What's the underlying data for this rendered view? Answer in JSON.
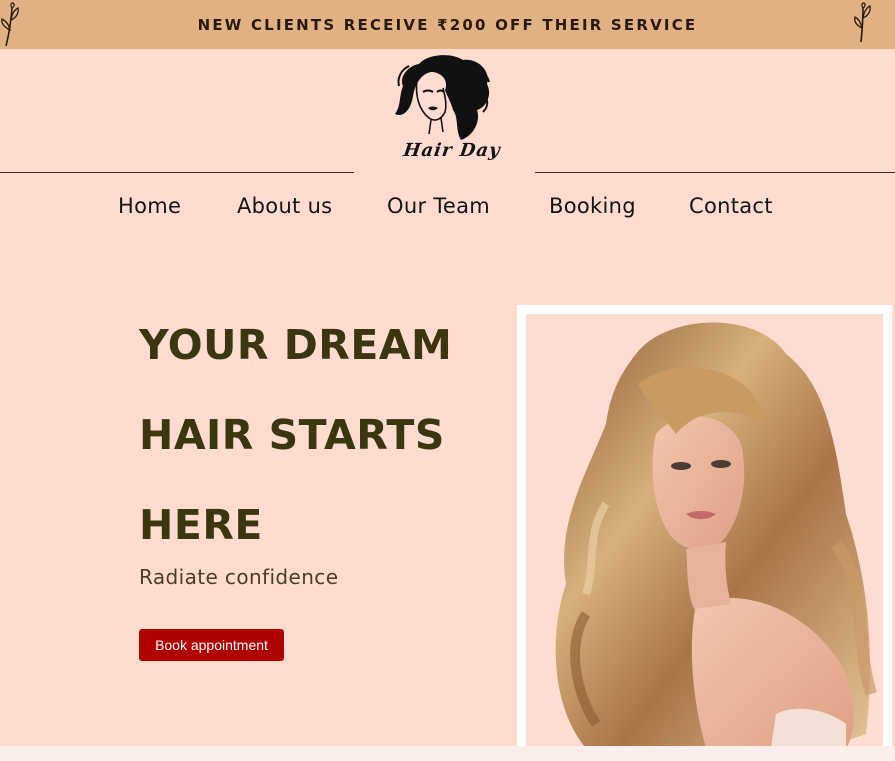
{
  "promo": {
    "text": "NEW CLIENTS RECEIVE ₹200 OFF THEIR SERVICE",
    "left_icon": "leaf-sprig-icon",
    "right_icon": "leaf-sprig-icon"
  },
  "brand": {
    "name": "Hair Day",
    "logo_icon": "woman-face-logo-icon"
  },
  "nav": {
    "items": [
      {
        "label": "Home"
      },
      {
        "label": "About us"
      },
      {
        "label": "Our Team"
      },
      {
        "label": "Booking"
      },
      {
        "label": "Contact"
      }
    ]
  },
  "hero": {
    "title_lines": [
      "YOUR DREAM",
      "HAIR STARTS",
      "HERE"
    ],
    "subtitle": "Radiate confidence",
    "cta_label": "Book appointment",
    "image_icon": "woman-with-long-wavy-hair-photo"
  },
  "colors": {
    "page_background": "#ffdbd0",
    "promo_background": "#e0b283",
    "heading": "#3b3510",
    "button": "#b10000"
  }
}
